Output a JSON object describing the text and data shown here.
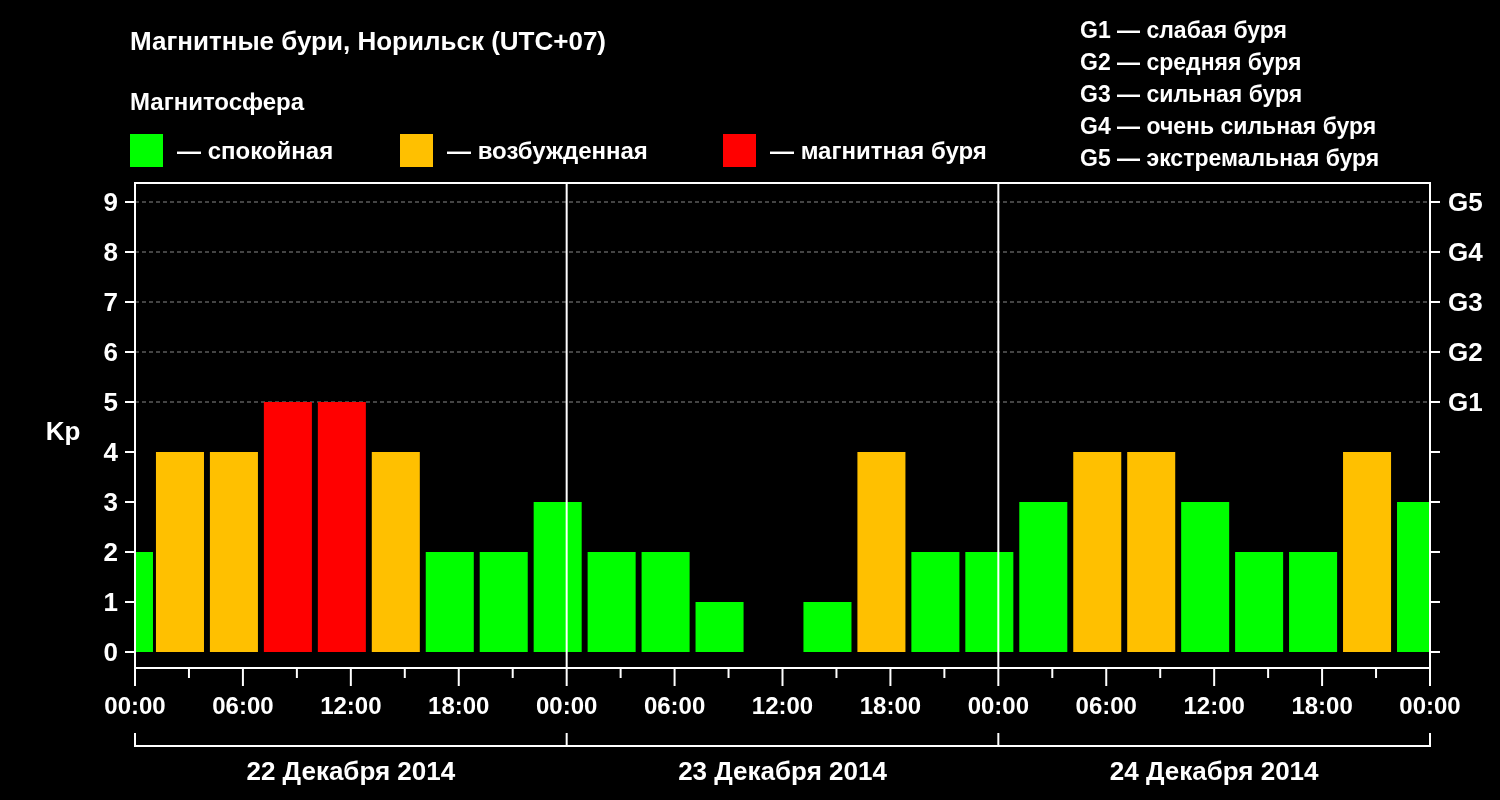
{
  "title": "Магнитные бури, Норильск (UTC+07)",
  "legend_title": "Магнитосфера",
  "legend": [
    {
      "label": "— спокойная",
      "color": "#00ff00"
    },
    {
      "label": "— возбужденная",
      "color": "#ffc000"
    },
    {
      "label": "— магнитная буря",
      "color": "#ff0000"
    }
  ],
  "storm_scale": [
    "G1 — слабая буря",
    "G2 — средняя буря",
    "G3 — сильная буря",
    "G4 — очень сильная буря",
    "G5 — экстремальная буря"
  ],
  "storm_levels": [
    "G5",
    "G4",
    "G3",
    "G2",
    "G1"
  ],
  "days": [
    "22 Декабря 2014",
    "23 Декабря 2014",
    "24 Декабря 2014"
  ],
  "chart_data": {
    "type": "bar",
    "ylabel": "Kp",
    "x": [
      "2014-12-22T00:30",
      "2014-12-22T02:30",
      "2014-12-22T05:30",
      "2014-12-22T08:30",
      "2014-12-22T11:30",
      "2014-12-22T14:30",
      "2014-12-22T17:30",
      "2014-12-22T20:30",
      "2014-12-22T23:30",
      "2014-12-23T02:30",
      "2014-12-23T05:30",
      "2014-12-23T08:30",
      "2014-12-23T11:30",
      "2014-12-23T14:30",
      "2014-12-23T17:30",
      "2014-12-23T20:30",
      "2014-12-23T23:30",
      "2014-12-24T02:30",
      "2014-12-24T05:30",
      "2014-12-24T08:30",
      "2014-12-24T11:30",
      "2014-12-24T14:30",
      "2014-12-24T17:30",
      "2014-12-24T20:30",
      "2014-12-24T23:05"
    ],
    "series": [
      {
        "values": [
          2,
          4,
          4,
          5,
          5,
          4,
          2,
          2,
          3,
          2,
          2,
          1,
          0,
          1,
          4,
          2,
          2,
          3,
          4,
          4,
          3,
          2,
          2,
          4,
          3
        ]
      }
    ],
    "xlim": [
      "2014-12-22T00:00",
      "2014-12-25T00:00"
    ],
    "ylim": [
      -0.32,
      9.38
    ],
    "grid": true,
    "xticks": [
      {
        "value": "2014-12-22T00:00",
        "label": "00:00"
      },
      {
        "value": "2014-12-22T06:00",
        "label": "06:00"
      },
      {
        "value": "2014-12-22T12:00",
        "label": "12:00"
      },
      {
        "value": "2014-12-22T18:00",
        "label": "18:00"
      },
      {
        "value": "2014-12-23T00:00",
        "label": "00:00"
      },
      {
        "value": "2014-12-23T06:00",
        "label": "06:00"
      },
      {
        "value": "2014-12-23T12:00",
        "label": "12:00"
      },
      {
        "value": "2014-12-23T18:00",
        "label": "18:00"
      },
      {
        "value": "2014-12-24T00:00",
        "label": "00:00"
      },
      {
        "value": "2014-12-24T06:00",
        "label": "06:00"
      },
      {
        "value": "2014-12-24T12:00",
        "label": "12:00"
      },
      {
        "value": "2014-12-24T18:00",
        "label": "18:00"
      },
      {
        "value": "2014-12-25T00:00",
        "label": "00:00"
      }
    ],
    "yticks": [
      0,
      1,
      2,
      3,
      4,
      5,
      6,
      7,
      8,
      9
    ]
  }
}
